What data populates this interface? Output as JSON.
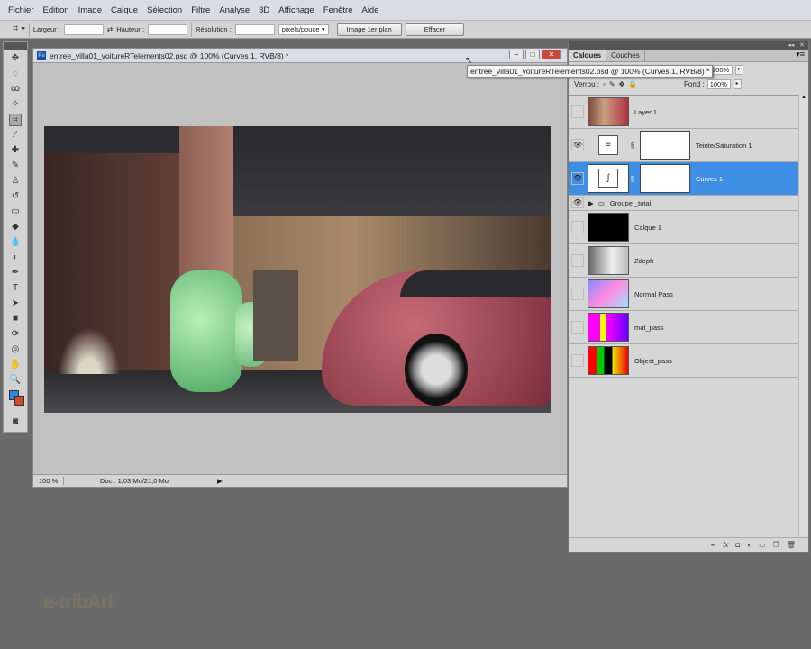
{
  "menu": [
    "Fichier",
    "Edition",
    "Image",
    "Calque",
    "Sélection",
    "Filtre",
    "Analyse",
    "3D",
    "Affichage",
    "Fenêtre",
    "Aide"
  ],
  "options": {
    "largeur": "Largeur :",
    "hauteur": "Hauteur :",
    "resolution": "Résolution :",
    "unit": "pixels/pouce",
    "front_image": "Image 1er plan",
    "clear": "Effacer"
  },
  "document": {
    "title": "entree_villa01_voitureRTelements02.psd @ 100% (Curves 1, RVB/8) *",
    "zoom": "100 %",
    "doc_info": "Doc : 1,03 Mo/21,0 Mo",
    "tooltip": "entree_villa01_voitureRTelements02.psd @ 100% (Curves 1, RVB/8) *"
  },
  "panel": {
    "tabs": [
      "Calques",
      "Couches"
    ],
    "opacity": "100%",
    "lock_label": "Verrou :",
    "fill_label": "Fond :",
    "fill": "100%",
    "layers": [
      {
        "name": "Layer 1",
        "visible": false,
        "type": "image"
      },
      {
        "name": "Teinte/Saturation 1",
        "visible": true,
        "type": "hue"
      },
      {
        "name": "Curves 1",
        "visible": true,
        "type": "curves",
        "selected": true
      },
      {
        "name": "Groupe _total",
        "visible": true,
        "type": "group"
      },
      {
        "name": "Calque 1",
        "visible": false,
        "type": "black"
      },
      {
        "name": "Zdeph",
        "visible": false,
        "type": "zdepth"
      },
      {
        "name": "Normal Pass",
        "visible": false,
        "type": "normal"
      },
      {
        "name": "mat_pass",
        "visible": false,
        "type": "mat"
      },
      {
        "name": "Object_pass",
        "visible": false,
        "type": "object"
      }
    ]
  },
  "watermark": "e-tribArt",
  "colors": {
    "selected": "#3e8ee6",
    "foreground": "#2a8ae0",
    "background": "#d9472b"
  }
}
